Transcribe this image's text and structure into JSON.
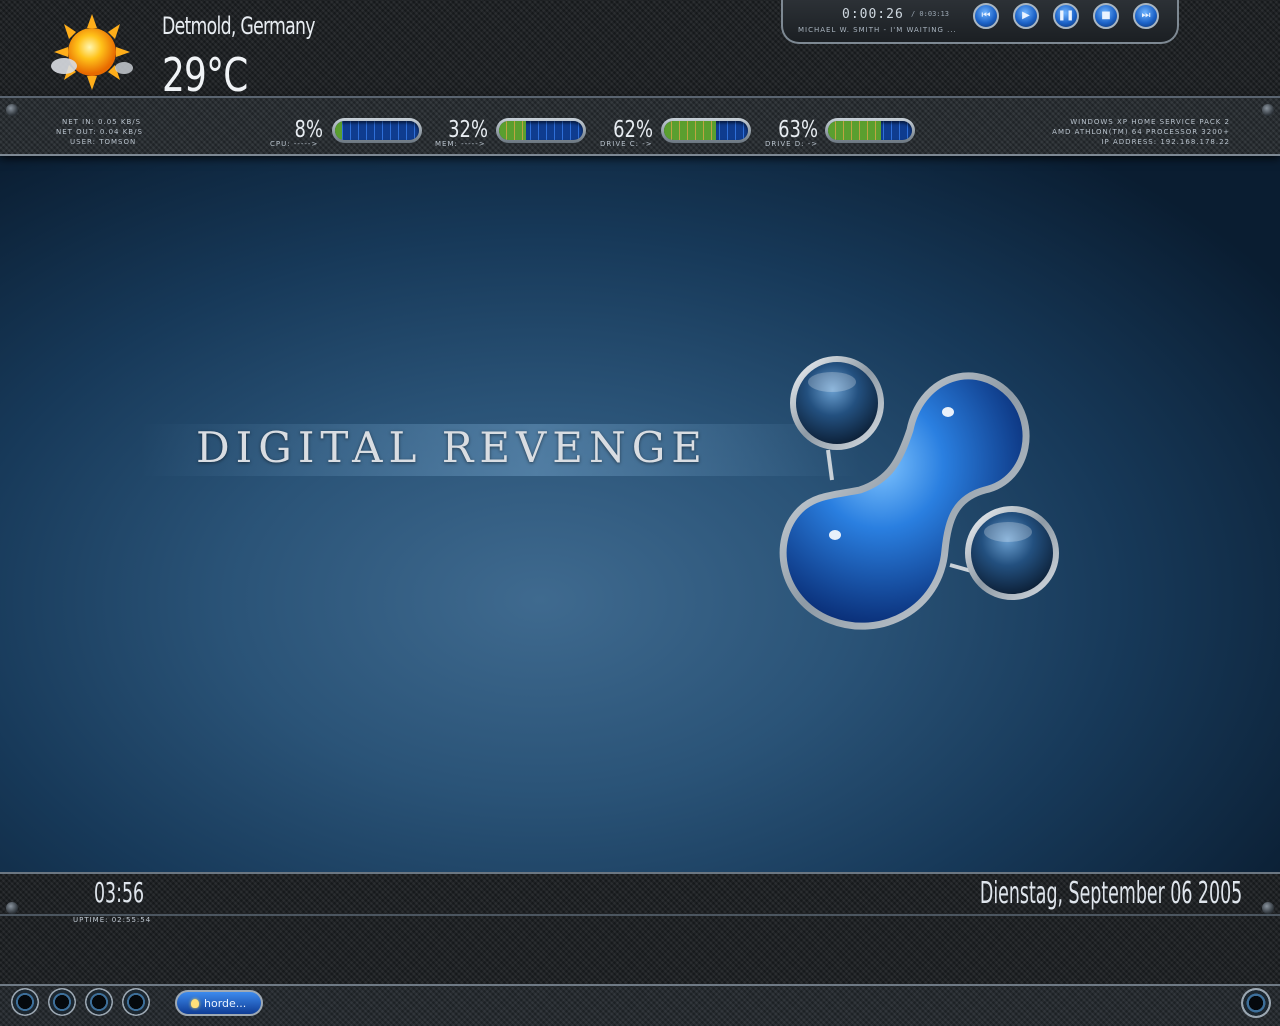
{
  "weather": {
    "icon": "sun-icon",
    "city": "Detmold, Germany",
    "temperature": "29°C"
  },
  "media_player": {
    "elapsed": "0:00:26",
    "total": "/ 0:03:13",
    "track": "MICHAEL W. SMITH - I'M WAITING ...",
    "buttons": [
      "previous-icon",
      "play-icon",
      "pause-icon",
      "stop-icon",
      "next-icon"
    ]
  },
  "network": {
    "net_in": "NET IN: 0.05 KB/S",
    "net_out": "NET OUT: 0.04 KB/S",
    "user": "USER: TOMSON"
  },
  "meters": [
    {
      "label": "CPU: ----->",
      "percent_text": "8%",
      "value": 8
    },
    {
      "label": "MEM: ----->",
      "percent_text": "32%",
      "value": 32
    },
    {
      "label": "DRIVE C: ->",
      "percent_text": "62%",
      "value": 62
    },
    {
      "label": "DRIVE D: ->",
      "percent_text": "63%",
      "value": 63
    }
  ],
  "system": {
    "os": "WINDOWS XP HOME SERVICE PACK 2",
    "cpu": "AMD ATHLON(TM) 64 PROCESSOR 3200+",
    "ip": "IP ADDRESS: 192.168.178.22"
  },
  "wallpaper": {
    "title": "DIGITAL REVENGE"
  },
  "clock": {
    "time": "03:56",
    "uptime": "UPTIME: 02:55:54",
    "date": "Dienstag, September 06  2005"
  },
  "taskbar": {
    "task_label": "horde..."
  },
  "colors": {
    "accent": "#1c63c8",
    "meter_green": "#5ea42a",
    "meter_orange": "#c6a63a"
  }
}
